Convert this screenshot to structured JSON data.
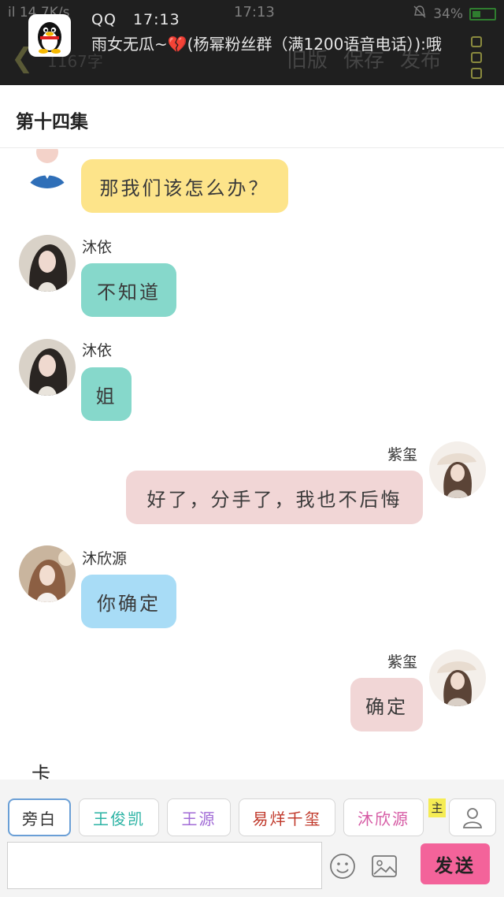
{
  "status_bar": {
    "left_text": "il 14.7K/s",
    "time": "17:13",
    "battery": "34%"
  },
  "toolbar": {
    "back_icon": "back-arrow-icon",
    "word_count": "1167字",
    "actions": [
      "旧版",
      "保存",
      "发布"
    ]
  },
  "notification": {
    "app": "QQ",
    "time": "17:13",
    "message_prefix": "雨女无瓜~",
    "heart": "💔",
    "message_suffix": "(杨幂粉丝群（满1200语音电话）):哦"
  },
  "episode": {
    "title": "第十四集"
  },
  "messages": [
    {
      "speaker": "",
      "text": "那我们该怎么办？",
      "side": "left",
      "color": "#fde48a"
    },
    {
      "speaker": "沐依",
      "text": "不知道",
      "side": "left",
      "color": "#86d8cb"
    },
    {
      "speaker": "沐依",
      "text": "姐",
      "side": "left",
      "color": "#86d8cb"
    },
    {
      "speaker": "紫玺",
      "text": "好了，分手了，我也不后悔",
      "side": "right",
      "color": "#f1d6d6"
    },
    {
      "speaker": "沐欣源",
      "text": "你确定",
      "side": "left",
      "color": "#a8dcf6"
    },
    {
      "speaker": "紫玺",
      "text": "确定",
      "side": "right",
      "color": "#f1d6d6"
    }
  ],
  "typed_text": "卡",
  "roles": {
    "items": [
      "旁白",
      "王俊凯",
      "王源",
      "易烊千玺",
      "沐欣源"
    ],
    "star_tag": "主"
  },
  "composer": {
    "input_value": "",
    "send_label": "发送"
  }
}
